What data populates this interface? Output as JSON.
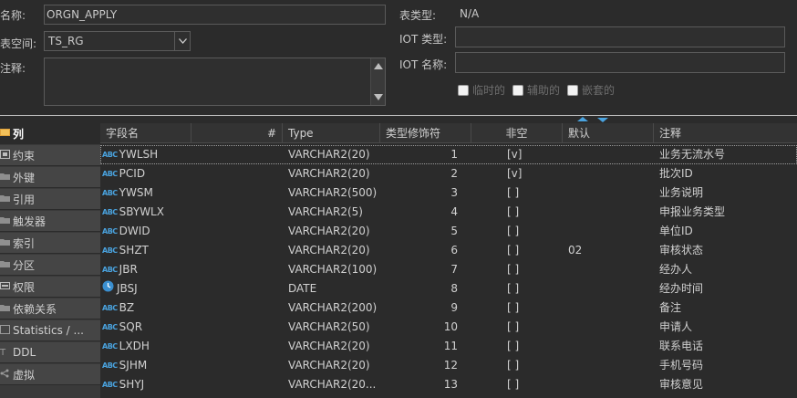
{
  "form": {
    "name_label": "名称:",
    "name_value": "ORGN_APPLY",
    "tablespace_label": "表空间:",
    "tablespace_value": "TS_RG",
    "comment_label": "注释:",
    "table_type_label": "表类型:",
    "table_type_value": "N/A",
    "iot_type_label": "IOT 类型:",
    "iot_name_label": "IOT 名称:",
    "checkboxes": [
      {
        "label": "临时的",
        "checked": false
      },
      {
        "label": "辅助的",
        "checked": false
      },
      {
        "label": "嵌套的",
        "checked": false
      }
    ]
  },
  "nav": {
    "items": [
      {
        "label": "列",
        "icon": "columns-icon",
        "active": true
      },
      {
        "label": "约束",
        "icon": "constraint-icon",
        "active": false
      },
      {
        "label": "外键",
        "icon": "folder-icon",
        "active": false
      },
      {
        "label": "引用",
        "icon": "folder-icon",
        "active": false
      },
      {
        "label": "触发器",
        "icon": "folder-icon",
        "active": false
      },
      {
        "label": "索引",
        "icon": "folder-icon",
        "active": false
      },
      {
        "label": "分区",
        "icon": "folder-icon",
        "active": false
      },
      {
        "label": "权限",
        "icon": "grants-icon",
        "active": false
      },
      {
        "label": "依赖关系",
        "icon": "folder-icon",
        "active": false
      },
      {
        "label": "Statistics / ...",
        "icon": "statistics-icon",
        "active": false
      },
      {
        "label": "DDL",
        "icon": "ddl-icon",
        "active": false
      },
      {
        "label": "虚拟",
        "icon": "virtual-icon",
        "active": false
      }
    ]
  },
  "grid": {
    "headers": {
      "name": "字段名",
      "num": "#",
      "type": "Type",
      "modifier": "类型修饰符",
      "not_null": "非空",
      "default": "默认",
      "comment": "注释"
    },
    "rows": [
      {
        "icon": "abc",
        "name": "YWLSH",
        "num": "1",
        "type": "VARCHAR2(20)",
        "not_null": "[v]",
        "default": "",
        "comment": "业务无流水号"
      },
      {
        "icon": "abc",
        "name": "PCID",
        "num": "2",
        "type": "VARCHAR2(20)",
        "not_null": "[v]",
        "default": "",
        "comment": "批次ID"
      },
      {
        "icon": "abc",
        "name": "YWSM",
        "num": "3",
        "type": "VARCHAR2(500)",
        "not_null": "[ ]",
        "default": "",
        "comment": "业务说明"
      },
      {
        "icon": "abc",
        "name": "SBYWLX",
        "num": "4",
        "type": "VARCHAR2(5)",
        "not_null": "[ ]",
        "default": "",
        "comment": "申报业务类型"
      },
      {
        "icon": "abc",
        "name": "DWID",
        "num": "5",
        "type": "VARCHAR2(20)",
        "not_null": "[ ]",
        "default": "",
        "comment": "单位ID"
      },
      {
        "icon": "abc",
        "name": "SHZT",
        "num": "6",
        "type": "VARCHAR2(20)",
        "not_null": "[ ]",
        "default": "02",
        "comment": "审核状态"
      },
      {
        "icon": "abc",
        "name": "JBR",
        "num": "7",
        "type": "VARCHAR2(100)",
        "not_null": "[ ]",
        "default": "",
        "comment": "经办人"
      },
      {
        "icon": "clock",
        "name": "JBSJ",
        "num": "8",
        "type": "DATE",
        "not_null": "[ ]",
        "default": "",
        "comment": "经办时间"
      },
      {
        "icon": "abc",
        "name": "BZ",
        "num": "9",
        "type": "VARCHAR2(200)",
        "not_null": "[ ]",
        "default": "",
        "comment": "备注"
      },
      {
        "icon": "abc",
        "name": "SQR",
        "num": "10",
        "type": "VARCHAR2(50)",
        "not_null": "[ ]",
        "default": "",
        "comment": "申请人"
      },
      {
        "icon": "abc",
        "name": "LXDH",
        "num": "11",
        "type": "VARCHAR2(20)",
        "not_null": "[ ]",
        "default": "",
        "comment": "联系电话"
      },
      {
        "icon": "abc",
        "name": "SJHM",
        "num": "12",
        "type": "VARCHAR2(20)",
        "not_null": "[ ]",
        "default": "",
        "comment": "手机号码"
      },
      {
        "icon": "abc",
        "name": "SHYJ",
        "num": "13",
        "type": "VARCHAR2(20...",
        "not_null": "[ ]",
        "default": "",
        "comment": "审核意见"
      }
    ]
  },
  "colors": {
    "background": "#2b2b2b",
    "accent": "#4aa3df",
    "text": "#d0d0d0"
  }
}
